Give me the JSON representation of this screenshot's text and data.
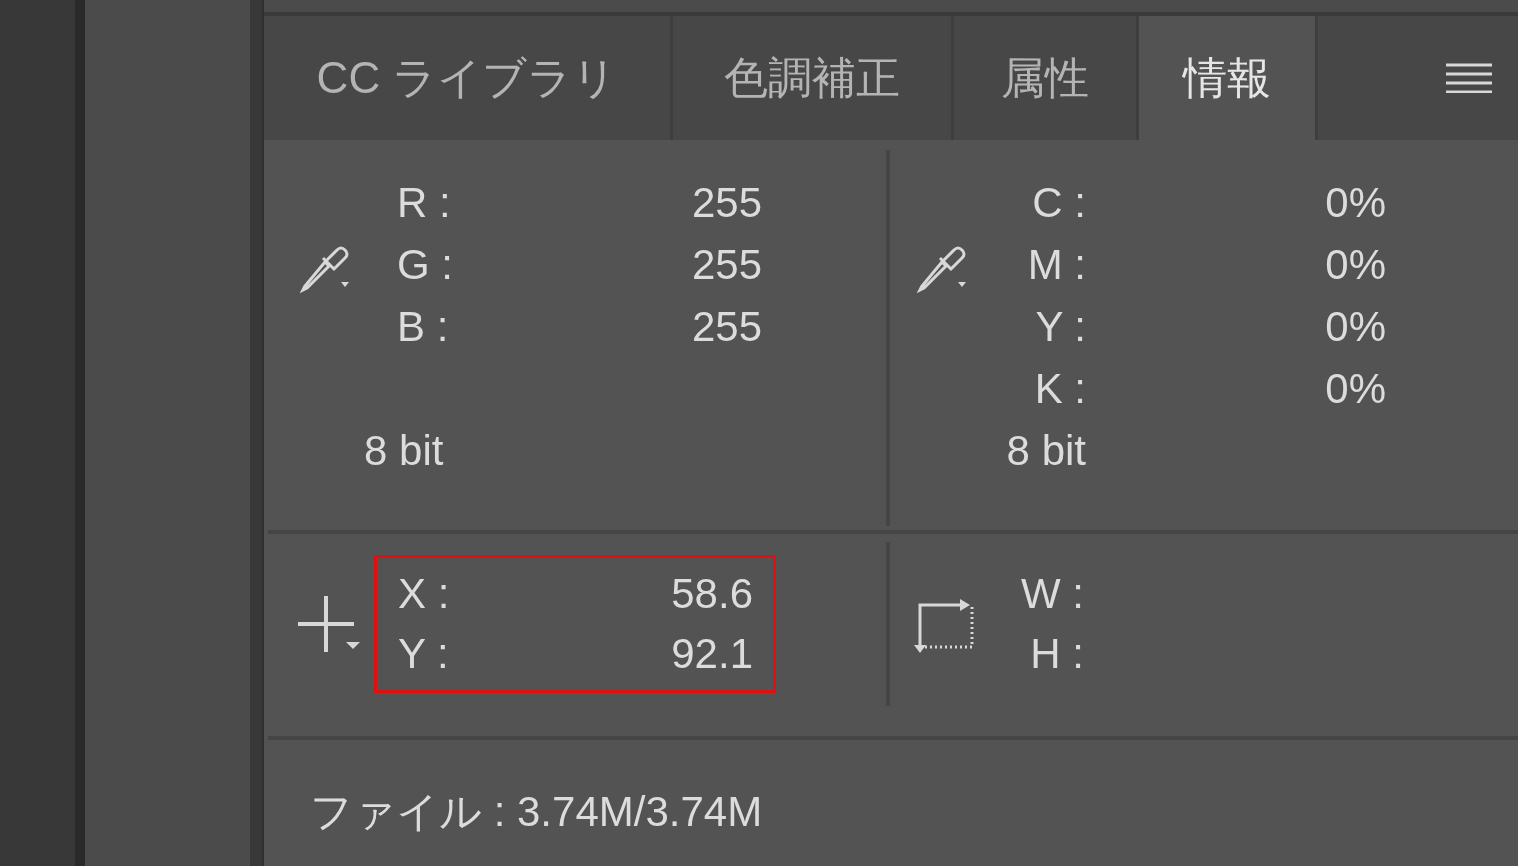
{
  "tabs": [
    {
      "label": "CC ライブラリ",
      "selected": false
    },
    {
      "label": "色調補正",
      "selected": false
    },
    {
      "label": "属性",
      "selected": false
    },
    {
      "label": "情報",
      "selected": true
    }
  ],
  "rgb": {
    "rows": [
      {
        "label": "R :",
        "value": "255"
      },
      {
        "label": "G :",
        "value": "255"
      },
      {
        "label": "B :",
        "value": "255"
      }
    ],
    "bit": "8 bit"
  },
  "cmyk": {
    "rows": [
      {
        "label": "C :",
        "value": "0%"
      },
      {
        "label": "M :",
        "value": "0%"
      },
      {
        "label": "Y :",
        "value": "0%"
      },
      {
        "label": "K :",
        "value": "0%"
      }
    ],
    "bit": "8 bit"
  },
  "position": {
    "highlighted": true,
    "rows": [
      {
        "label": "X :",
        "value": "58.6"
      },
      {
        "label": "Y :",
        "value": "92.1"
      }
    ]
  },
  "size": {
    "rows": [
      {
        "label": "W :"
      },
      {
        "label": "H :"
      }
    ]
  },
  "file_info": "ファイル : 3.74M/3.74M"
}
